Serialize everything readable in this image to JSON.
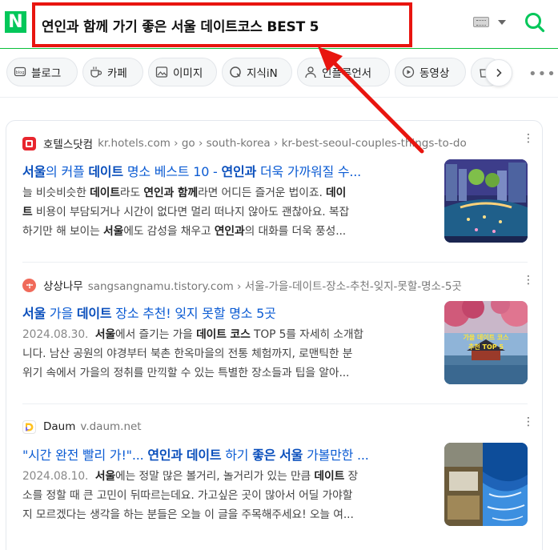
{
  "header": {
    "logo": "N",
    "query": "연인과 함께 가기 좋은 서울 데이트코스 BEST 5"
  },
  "tabs": [
    {
      "label": "블로그",
      "icon": "blog-icon"
    },
    {
      "label": "카페",
      "icon": "cafe-icon"
    },
    {
      "label": "이미지",
      "icon": "image-icon"
    },
    {
      "label": "지식iN",
      "icon": "knowledge-icon"
    },
    {
      "label": "인플루언서",
      "icon": "influencer-icon"
    },
    {
      "label": "동영상",
      "icon": "video-icon"
    },
    {
      "label": "",
      "icon": "shopping-icon"
    }
  ],
  "colors": {
    "brand": "#03c75a",
    "highlight_box": "#e8150f",
    "link": "#0b5bd3"
  },
  "results": [
    {
      "site": "호텔스닷컴",
      "url": "kr.hotels.com › go › south-korea › kr-best-seoul-couples-things-to-do",
      "title_parts": [
        "서울",
        "의 커플 ",
        "데이트",
        " 명소 베스트 10 - ",
        "연인과",
        " 더욱 가까워질 수..."
      ],
      "desc_lines": [
        "늘 비슷비슷한 데이트라도 연인과 함께라면 어디든 즐거운 법이죠. 데이",
        "트 비용이 부담되거나 시간이 없다면 멀리 떠나지 않아도 괜찮아요. 복잡",
        "하기만 해 보이는 서울에도 감성을 채우고 연인과의 대화를 더욱 풍성..."
      ]
    },
    {
      "site": "상상나무",
      "url": "sangsangnamu.tistory.com › 서울-가을-데이트-장소-추천-잊지-못할-명소-5곳",
      "title_parts": [
        "서울",
        " 가을 ",
        "데이트",
        " 장소 추천! 잊지 못할 명소 5곳"
      ],
      "date": "2024.08.30.",
      "desc_lines": [
        "서울에서 즐기는 가을 데이트 코스 TOP 5를 자세히 소개합",
        "니다. 남산 공원의 야경부터 북촌 한옥마을의 전통 체험까지, 로맨틱한 분",
        "위기 속에서 가을의 정취를 만끽할 수 있는 특별한 장소들과 팁을 알아..."
      ],
      "thumb_caption": "가을 데이트 코스 추천 TOP 5"
    },
    {
      "site": "Daum",
      "url": "v.daum.net",
      "title_parts": [
        "\"시간 완전 빨리 가!\"... ",
        "연인과",
        " ",
        "데이트",
        " 하기 ",
        "좋은",
        " ",
        "서울",
        " 가볼만한 ..."
      ],
      "date": "2024.08.10.",
      "desc_lines": [
        "서울에는 정말 많은 볼거리, 놀거리가 있는 만큼 데이트 장",
        "소를 정할 때 큰 고민이 뒤따르는데요. 가고싶은 곳이 많아서 어딜 가야할",
        "지 모르겠다는 생각을 하는 분들은 오늘 이 글을 주목해주세요! 오늘 여..."
      ]
    }
  ]
}
